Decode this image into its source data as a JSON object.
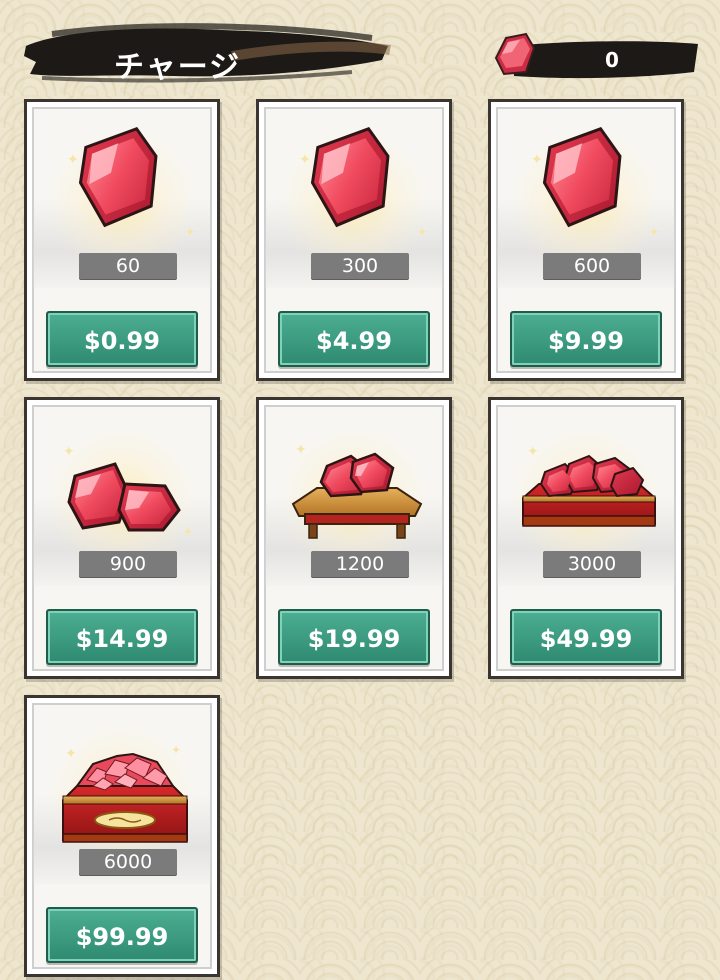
{
  "header": {
    "title": "チャージ"
  },
  "currency": {
    "icon": "red-gem-icon",
    "value": "0"
  },
  "colors": {
    "button": "#3a9b7f",
    "gem": "#e8435a",
    "banner": "#1d1916"
  },
  "packs": [
    {
      "amount": "60",
      "price": "$0.99",
      "icon": "single-gem-icon"
    },
    {
      "amount": "300",
      "price": "$4.99",
      "icon": "single-gem-icon"
    },
    {
      "amount": "600",
      "price": "$9.99",
      "icon": "single-gem-icon"
    },
    {
      "amount": "900",
      "price": "$14.99",
      "icon": "gem-pair-icon"
    },
    {
      "amount": "1200",
      "price": "$19.99",
      "icon": "gem-tray-icon"
    },
    {
      "amount": "3000",
      "price": "$49.99",
      "icon": "gem-chest-icon"
    },
    {
      "amount": "6000",
      "price": "$99.99",
      "icon": "gem-treasure-chest-icon"
    }
  ]
}
